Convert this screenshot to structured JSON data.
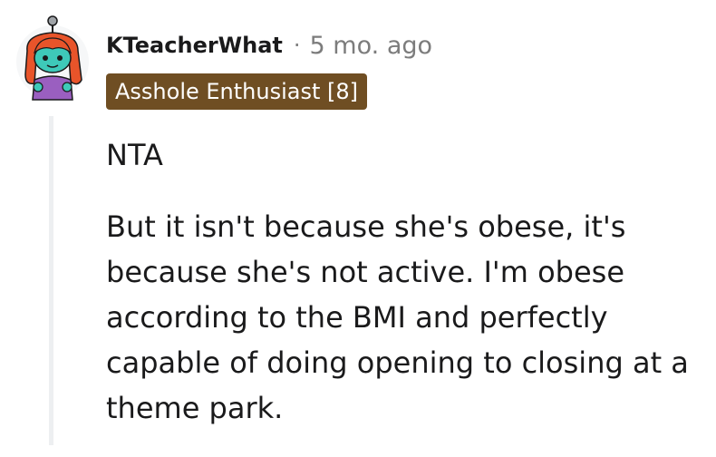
{
  "comment": {
    "author": "KTeacherWhat",
    "separator": "·",
    "timestamp": "5 mo. ago",
    "flair": "Asshole Enthusiast [8]",
    "paragraphs": [
      "NTA",
      "But it isn't because she's obese, it's because she's not active. I'm obese according to the BMI and perfectly capable of doing opening to closing at a theme park."
    ]
  },
  "colors": {
    "flair_background": "#6f4e23",
    "flair_text": "#ffffff",
    "meta_gray": "#7c7c7c",
    "thread_line": "#edeff1",
    "avatar_hair": "#e8542a",
    "avatar_face": "#3ec9b9",
    "avatar_shirt": "#9a5fc0"
  },
  "icons": {
    "avatar": "snoo-avatar-icon"
  }
}
